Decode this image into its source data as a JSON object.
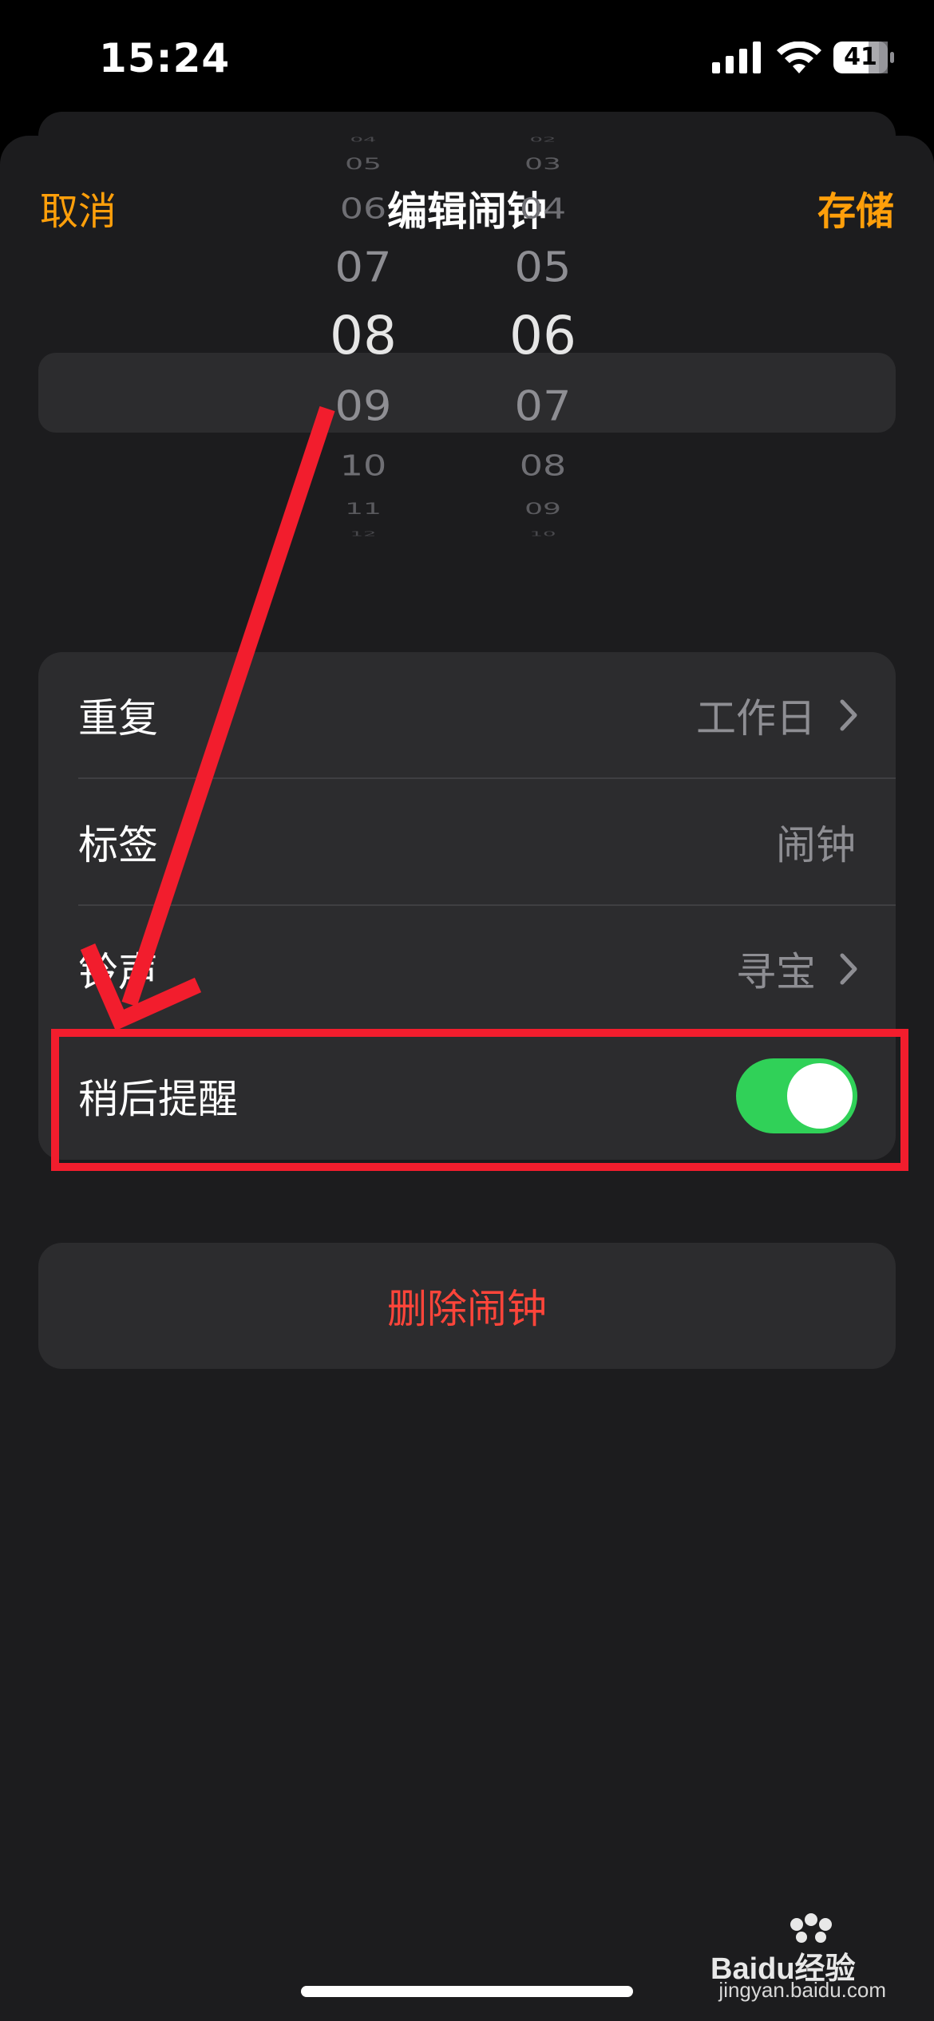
{
  "status_bar": {
    "time": "15:24",
    "battery": "41",
    "icons": [
      "signal-icon",
      "wifi-icon",
      "battery-icon"
    ]
  },
  "nav": {
    "cancel": "取消",
    "title": "编辑闹钟",
    "save": "存储"
  },
  "picker": {
    "hours": [
      "04",
      "05",
      "06",
      "07",
      "08",
      "09",
      "10",
      "11",
      "12"
    ],
    "minutes": [
      "02",
      "03",
      "04",
      "05",
      "06",
      "07",
      "08",
      "09",
      "10"
    ],
    "selected_hour": "08",
    "selected_minute": "06"
  },
  "settings": {
    "repeat": {
      "label": "重复",
      "value": "工作日"
    },
    "label": {
      "label": "标签",
      "value": "闹钟"
    },
    "sound": {
      "label": "铃声",
      "value": "寻宝"
    },
    "snooze": {
      "label": "稍后提醒",
      "on": true
    }
  },
  "delete_label": "删除闹钟",
  "watermark": {
    "logo": "Baidu经验",
    "url": "jingyan.baidu.com"
  },
  "colors": {
    "accent": "#ff9f0a",
    "destructive": "#ff453a",
    "toggle_on": "#30d158",
    "annotation": "#f21d2d"
  }
}
